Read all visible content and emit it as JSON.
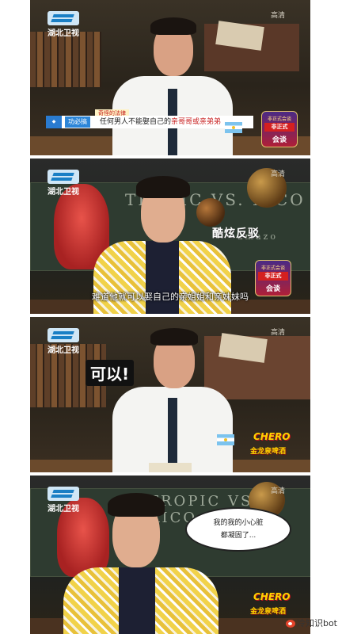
{
  "channel_logo": "湖北卫视",
  "quality_label": "高清",
  "panel1": {
    "law_tag": "奇怪的法律",
    "law_label": "功必搞",
    "law_text_plain": "任何男人不能娶自己的",
    "law_text_highlight": "亲哥哥或亲弟弟",
    "show_badge_top": "非正式会谈",
    "show_badge_mid": "非正式",
    "show_badge_bottom": "会谈"
  },
  "panel2": {
    "chalk_text": "TROPIC VS. RICO",
    "chalk_text_2": "amazo",
    "caption": "酷炫反驳",
    "subtitle": "难道他就可以娶自己的亲姐姐和亲妹妹吗",
    "show_badge_top": "非正式会谈",
    "show_badge_mid": "非正式",
    "show_badge_bottom": "会谈"
  },
  "panel3": {
    "caption": "可以!",
    "sponsor_top": "CHERO",
    "sponsor_bottom": "金龙泉啤酒"
  },
  "panel4": {
    "chalk_text": "TROPIC VS. RICO",
    "chalk_text_2": "amazo",
    "bubble_line1": "我的我的小心脏",
    "bubble_line2": "都凝固了...",
    "sponsor_top": "CHERO",
    "sponsor_bottom": "金龙泉啤酒"
  },
  "watermark": "冷知识bot",
  "colors": {
    "logo_blue": "#1a7fc5",
    "highlight_red": "#c81e1e",
    "sponsor_yellow": "#ffd400"
  }
}
